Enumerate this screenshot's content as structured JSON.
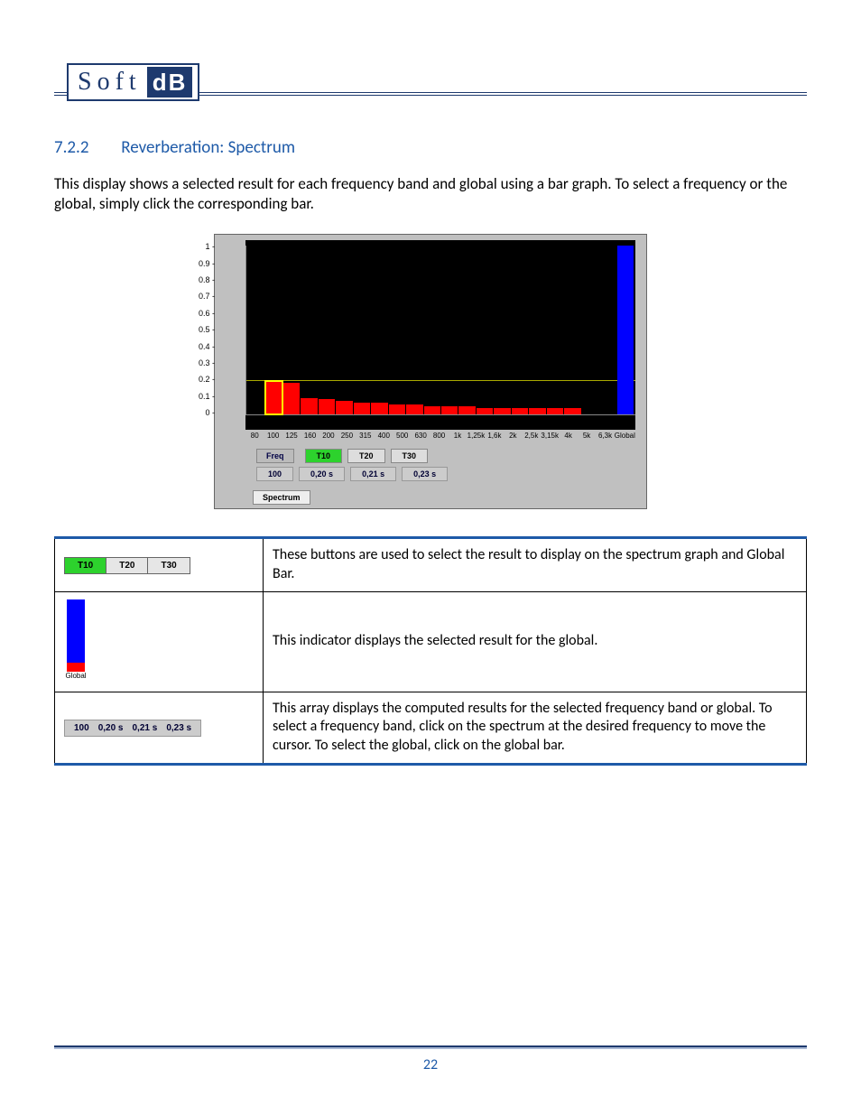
{
  "logo": {
    "soft": "Soft",
    "db": "dB"
  },
  "heading": {
    "num": "7.2.2",
    "title": "Reverberation: Spectrum"
  },
  "intro": "This display shows a selected result for each frequency band and global using a bar graph. To select a frequency or the global, simply click the corresponding bar.",
  "chart_data": {
    "type": "bar",
    "title": "",
    "xlabel": "",
    "ylabel": "",
    "ylim": [
      0,
      1
    ],
    "yticks": [
      "1",
      "0.9",
      "0.8",
      "0.7",
      "0.6",
      "0.5",
      "0.4",
      "0.3",
      "0.2",
      "0.1",
      "0"
    ],
    "gridline_y": 0.2,
    "categories": [
      "80",
      "100",
      "125",
      "160",
      "200",
      "250",
      "315",
      "400",
      "500",
      "630",
      "800",
      "1k",
      "1,25k",
      "1,6k",
      "2k",
      "2,5k",
      "3,15k",
      "4k",
      "5k",
      "6,3k",
      "Global"
    ],
    "values": [
      0,
      0.2,
      0.19,
      0.1,
      0.09,
      0.08,
      0.07,
      0.07,
      0.06,
      0.06,
      0.05,
      0.05,
      0.05,
      0.04,
      0.04,
      0.04,
      0.04,
      0.04,
      0.04,
      0,
      1.0
    ],
    "selected_index": 1,
    "global_index": 20
  },
  "controls": {
    "freq_label": "Freq",
    "buttons": [
      "T10",
      "T20",
      "T30"
    ],
    "selected_button": "T10",
    "values_row": [
      "100",
      "0,20 s",
      "0,21 s",
      "0,23 s"
    ],
    "tab": "Spectrum"
  },
  "table": {
    "rows": [
      {
        "desc": "These buttons are used to select the result to display on the spectrum graph and Global Bar."
      },
      {
        "desc": "This indicator displays the selected result for the global."
      },
      {
        "desc": "This array displays the computed results for the selected frequency band or global. To select a frequency band, click on the spectrum at the desired frequency to move the cursor. To select the global, click on the global bar."
      }
    ],
    "mini_buttons": [
      "T10",
      "T20",
      "T30"
    ],
    "mini_global_label": "Global",
    "mini_values": [
      "100",
      "0,20 s",
      "0,21 s",
      "0,23 s"
    ]
  },
  "page_number": "22"
}
